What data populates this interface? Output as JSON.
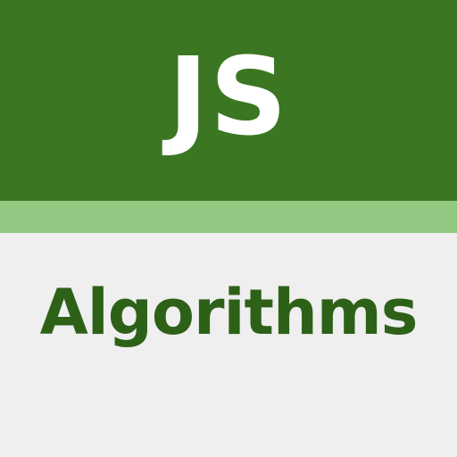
{
  "logo": {
    "title": "JS",
    "subtitle": "Algorithms"
  },
  "colors": {
    "top_band": "#3b7722",
    "accent_stripe": "#93c882",
    "bottom_panel": "#efefef",
    "title_text": "#ffffff",
    "subtitle_text": "#2e6118"
  }
}
